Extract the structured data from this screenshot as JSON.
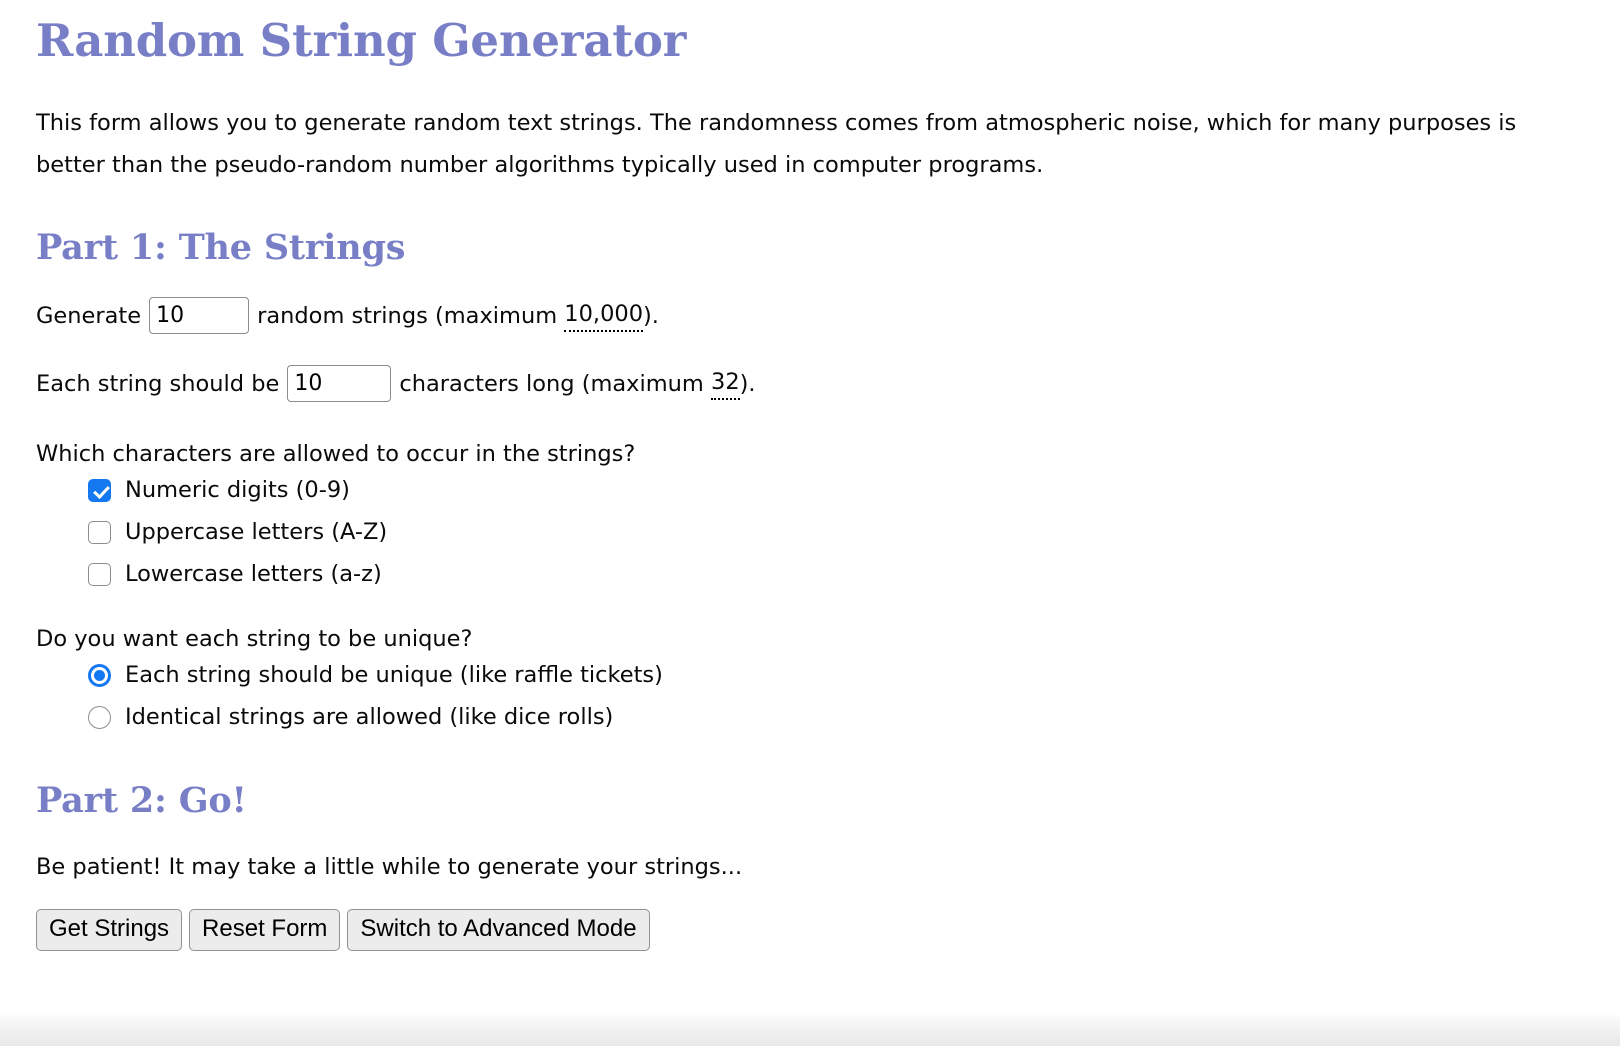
{
  "page": {
    "title": "Random String Generator",
    "intro": "This form allows you to generate random text strings. The randomness comes from atmospheric noise, which for many purposes is better than the pseudo-random number algorithms typically used in computer programs."
  },
  "part1": {
    "heading": "Part 1: The Strings",
    "generate": {
      "prefix": "Generate",
      "value": "10",
      "suffix_before_max": "random strings (maximum",
      "max": "10,000",
      "suffix_after_max": ")."
    },
    "length": {
      "prefix": "Each string should be",
      "value": "10",
      "suffix_before_max": "characters long (maximum",
      "max": "32",
      "suffix_after_max": ")."
    },
    "charset": {
      "question": "Which characters are allowed to occur in the strings?",
      "options": [
        {
          "label": "Numeric digits (0-9)",
          "checked": true
        },
        {
          "label": "Uppercase letters (A-Z)",
          "checked": false
        },
        {
          "label": "Lowercase letters (a-z)",
          "checked": false
        }
      ]
    },
    "uniqueness": {
      "question": "Do you want each string to be unique?",
      "options": [
        {
          "label": "Each string should be unique (like raffle tickets)",
          "selected": true
        },
        {
          "label": "Identical strings are allowed (like dice rolls)",
          "selected": false
        }
      ]
    }
  },
  "part2": {
    "heading": "Part 2: Go!",
    "note": "Be patient! It may take a little while to generate your strings...",
    "buttons": {
      "get_strings": "Get Strings",
      "reset_form": "Reset Form",
      "advanced_mode": "Switch to Advanced Mode"
    }
  },
  "colors": {
    "heading": "#787fc6",
    "accent_control": "#1478f0",
    "text": "#0a0a0a",
    "button_bg": "#ececec",
    "button_border": "#919191"
  }
}
